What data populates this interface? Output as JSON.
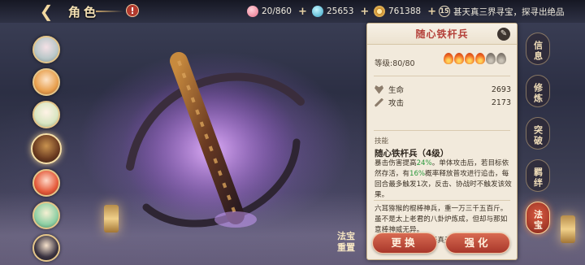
{
  "topbar": {
    "title": "角色",
    "alert": "!",
    "peach": "20/860",
    "jade": "25653",
    "coin": "761388",
    "notice_badge": "15",
    "notice": "甚天真三界寻宝，探寻出绝品"
  },
  "roster": {
    "count": 7,
    "active_index": 3
  },
  "reset_button": "法宝\n重置",
  "panel": {
    "item_name": "随心铁杆兵",
    "level_label": "等级:80/80",
    "flames_lit": 4,
    "flames_total": 6,
    "stats": [
      {
        "label": "生命",
        "value": "2693"
      },
      {
        "label": "攻击",
        "value": "2173"
      }
    ],
    "skill_section": "技能",
    "skill_title": "随心铁杆兵（4级）",
    "skill_desc_1": "暴击伤害提高",
    "skill_desc_pct1": "24%",
    "skill_desc_2": "。单体攻击后，若目标依然存活，有",
    "skill_desc_pct2": "16%",
    "skill_desc_3": "概率释放普攻进行追击，每回合最多触发1次，反击、协战时不触发该效果。",
    "lore_1": "六耳猕猴的棍棒神兵，重一万三千五百斤。",
    "lore_2": "虽不是太上老君的八卦炉炼成，但却与那如意棒神威无异。",
    "lore_3": "盖为神通多变化，无真无假两相平。",
    "btn_replace": "更换",
    "btn_enhance": "强化"
  },
  "side_tabs": [
    {
      "label": "信息",
      "active": false
    },
    {
      "label": "修炼",
      "active": false
    },
    {
      "label": "突破",
      "active": false
    },
    {
      "label": "羁绊",
      "active": false
    },
    {
      "label": "法宝",
      "active": true
    }
  ],
  "colors": {
    "accent_red": "#b4413a",
    "button_red": "#a8372a",
    "highlight_green": "#2d9a3e",
    "panel_bg": "#f2eadc"
  }
}
